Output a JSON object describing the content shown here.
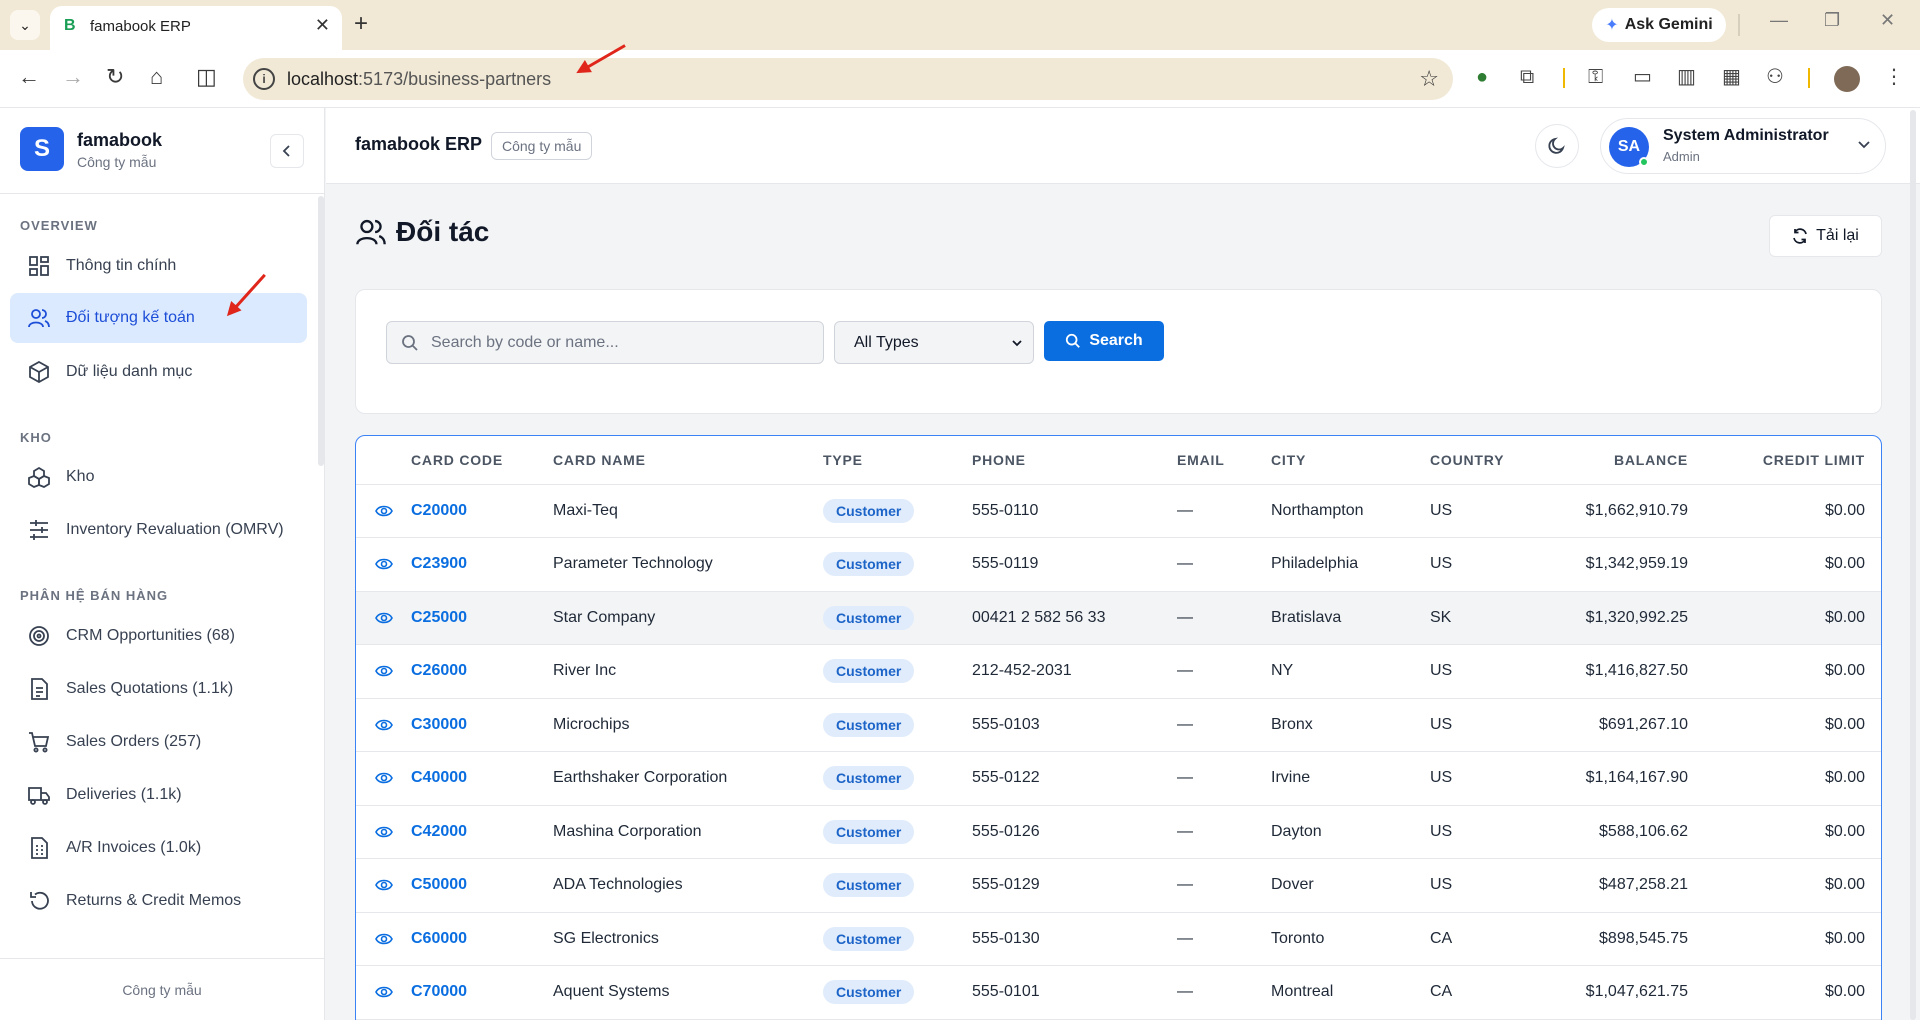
{
  "browser": {
    "tab_title": "famabook ERP",
    "tab_favicon": "B",
    "url_host": "localhost",
    "url_path": ":5173/business-partners",
    "gemini_label": "Ask Gemini"
  },
  "brand": {
    "logo_letter": "S",
    "name": "famabook",
    "subtitle": "Công ty mẫu"
  },
  "sidebar": {
    "sections": [
      {
        "label": "OVERVIEW"
      },
      {
        "label": "KHO"
      },
      {
        "label": "PHÂN HỆ BÁN HÀNG"
      }
    ],
    "items": [
      {
        "label": "Thông tin chính",
        "icon": "dashboard-icon"
      },
      {
        "label": "Đối tượng kế toán",
        "icon": "users-icon",
        "active": true
      },
      {
        "label": "Dữ liệu danh mục",
        "icon": "box-icon"
      },
      {
        "label": "Kho",
        "icon": "boxes-icon"
      },
      {
        "label": "Inventory Revaluation (OMRV)",
        "icon": "sliders-icon"
      },
      {
        "label": "CRM Opportunities (68)",
        "icon": "target-icon"
      },
      {
        "label": "Sales Quotations (1.1k)",
        "icon": "document-icon"
      },
      {
        "label": "Sales Orders (257)",
        "icon": "cart-icon"
      },
      {
        "label": "Deliveries (1.1k)",
        "icon": "truck-icon"
      },
      {
        "label": "A/R Invoices (1.0k)",
        "icon": "invoice-icon"
      },
      {
        "label": "Returns & Credit Memos",
        "icon": "return-icon"
      }
    ],
    "footer": "Công ty mẫu"
  },
  "header": {
    "app_title": "famabook ERP",
    "company_chip": "Công ty mẫu",
    "user": {
      "initials": "SA",
      "name": "System Administrator",
      "role": "Admin"
    }
  },
  "page": {
    "title": "Đối tác",
    "reload_label": "Tải lại"
  },
  "filters": {
    "search_placeholder": "Search by code or name...",
    "search_value": "",
    "type_selected": "All Types",
    "search_button": "Search"
  },
  "table": {
    "columns": [
      "",
      "CARD CODE",
      "CARD NAME",
      "TYPE",
      "PHONE",
      "EMAIL",
      "CITY",
      "COUNTRY",
      "BALANCE",
      "CREDIT LIMIT"
    ],
    "rows": [
      {
        "code": "C20000",
        "name": "Maxi-Teq",
        "type": "Customer",
        "phone": "555-0110",
        "email": "—",
        "city": "Northampton",
        "country": "US",
        "balance": "$1,662,910.79",
        "credit": "$0.00"
      },
      {
        "code": "C23900",
        "name": "Parameter Technology",
        "type": "Customer",
        "phone": "555-0119",
        "email": "—",
        "city": "Philadelphia",
        "country": "US",
        "balance": "$1,342,959.19",
        "credit": "$0.00"
      },
      {
        "code": "C25000",
        "name": "Star Company",
        "type": "Customer",
        "phone": "00421 2 582 56 33",
        "email": "—",
        "city": "Bratislava",
        "country": "SK",
        "balance": "$1,320,992.25",
        "credit": "$0.00"
      },
      {
        "code": "C26000",
        "name": "River Inc",
        "type": "Customer",
        "phone": "212-452-2031",
        "email": "—",
        "city": "NY",
        "country": "US",
        "balance": "$1,416,827.50",
        "credit": "$0.00"
      },
      {
        "code": "C30000",
        "name": "Microchips",
        "type": "Customer",
        "phone": "555-0103",
        "email": "—",
        "city": "Bronx",
        "country": "US",
        "balance": "$691,267.10",
        "credit": "$0.00"
      },
      {
        "code": "C40000",
        "name": "Earthshaker Corporation",
        "type": "Customer",
        "phone": "555-0122",
        "email": "—",
        "city": "Irvine",
        "country": "US",
        "balance": "$1,164,167.90",
        "credit": "$0.00"
      },
      {
        "code": "C42000",
        "name": "Mashina Corporation",
        "type": "Customer",
        "phone": "555-0126",
        "email": "—",
        "city": "Dayton",
        "country": "US",
        "balance": "$588,106.62",
        "credit": "$0.00"
      },
      {
        "code": "C50000",
        "name": "ADA Technologies",
        "type": "Customer",
        "phone": "555-0129",
        "email": "—",
        "city": "Dover",
        "country": "US",
        "balance": "$487,258.21",
        "credit": "$0.00"
      },
      {
        "code": "C60000",
        "name": "SG Electronics",
        "type": "Customer",
        "phone": "555-0130",
        "email": "—",
        "city": "Toronto",
        "country": "CA",
        "balance": "$898,545.75",
        "credit": "$0.00"
      },
      {
        "code": "C70000",
        "name": "Aquent Systems",
        "type": "Customer",
        "phone": "555-0101",
        "email": "—",
        "city": "Montreal",
        "country": "CA",
        "balance": "$1,047,621.75",
        "credit": "$0.00"
      }
    ]
  },
  "colors": {
    "accent": "#0b6ee0",
    "brand": "#2563eb",
    "active_bg": "#dbeafe",
    "annotation_arrow": "#e0261b"
  }
}
